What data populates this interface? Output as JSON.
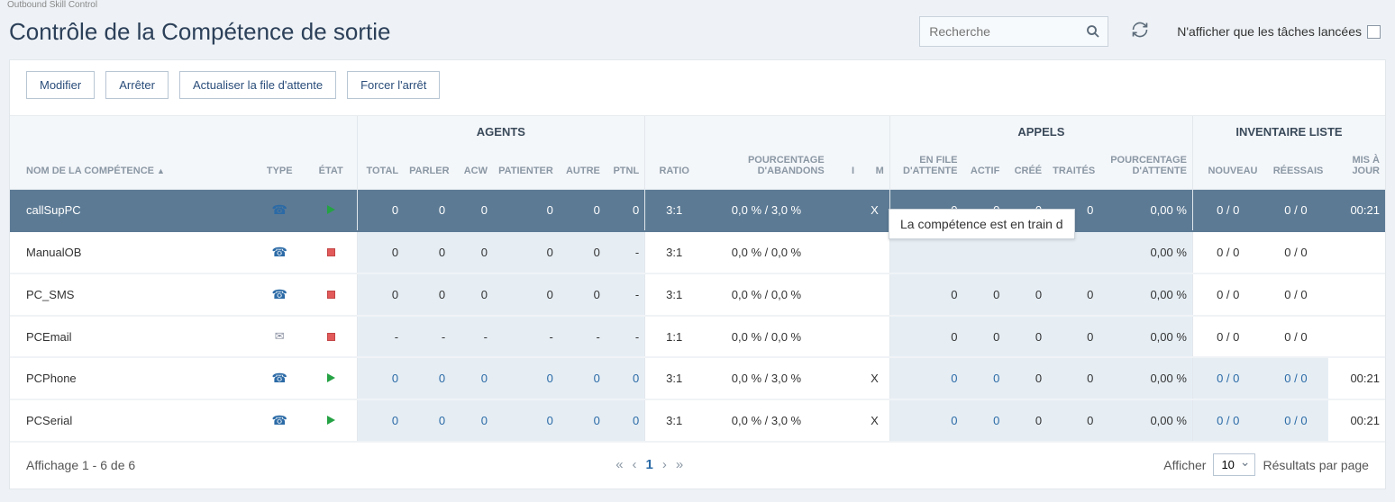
{
  "top_fragment": "Outbound Skill Control",
  "page_title": "Contrôle de la Compétence de sortie",
  "search": {
    "placeholder": "Recherche"
  },
  "show_only_label": "N'afficher que les tâches lancées",
  "buttons": {
    "modify": "Modifier",
    "stop": "Arrêter",
    "refresh_queue": "Actualiser la file d'attente",
    "force_stop": "Forcer l'arrêt"
  },
  "group_headers": {
    "blank": "",
    "agents": "AGENTS",
    "ratio_section": "",
    "calls": "APPELS",
    "inventory": "INVENTAIRE LISTE"
  },
  "columns": {
    "skill_name": "NOM DE LA COMPÉTENCE",
    "type": "TYPE",
    "state": "ÉTAT",
    "total": "TOTAL",
    "talking": "PARLER",
    "acw": "ACW",
    "waiting": "PATIENTER",
    "other": "AUTRE",
    "ptnl": "PTNL",
    "ratio": "RATIO",
    "abandon_pct": "POURCENTAGE D'ABANDONS",
    "i": "I",
    "m": "M",
    "queued": "EN FILE D'ATTENTE",
    "active": "ACTIF",
    "created": "CRÉÉ",
    "handled": "TRAITÉS",
    "wait_pct": "POURCENTAGE D'ATTENTE",
    "new": "NOUVEAU",
    "retries": "RÉESSAIS",
    "updated": "MIS À JOUR"
  },
  "rows": [
    {
      "name": "callSupPC",
      "type_icon": "phone",
      "state": "green",
      "link": false,
      "selected": true,
      "total": "0",
      "talking": "0",
      "acw": "0",
      "waiting": "0",
      "other": "0",
      "ptnl": "0",
      "ratio": "3:1",
      "abandon": "0,0 % / 3,0 %",
      "i": "",
      "m": "X",
      "queued": "0",
      "active": "0",
      "created": "0",
      "handled": "0",
      "waitpct": "0,00 %",
      "new": "0 / 0",
      "retries": "0 / 0",
      "updated": "00:21"
    },
    {
      "name": "ManualOB",
      "type_icon": "phone",
      "state": "red",
      "link": false,
      "selected": false,
      "total": "0",
      "talking": "0",
      "acw": "0",
      "waiting": "0",
      "other": "0",
      "ptnl": "-",
      "ratio": "3:1",
      "abandon": "0,0 % / 0,0 %",
      "i": "",
      "m": "",
      "queued": "",
      "active": "",
      "created": "",
      "handled": "",
      "waitpct": "0,00 %",
      "new": "0 / 0",
      "retries": "0 / 0",
      "updated": ""
    },
    {
      "name": "PC_SMS",
      "type_icon": "phone",
      "state": "red",
      "link": false,
      "selected": false,
      "total": "0",
      "talking": "0",
      "acw": "0",
      "waiting": "0",
      "other": "0",
      "ptnl": "-",
      "ratio": "3:1",
      "abandon": "0,0 % / 0,0 %",
      "i": "",
      "m": "",
      "queued": "0",
      "active": "0",
      "created": "0",
      "handled": "0",
      "waitpct": "0,00 %",
      "new": "0 / 0",
      "retries": "0 / 0",
      "updated": ""
    },
    {
      "name": "PCEmail",
      "type_icon": "mail",
      "state": "red",
      "link": false,
      "selected": false,
      "total": "-",
      "talking": "-",
      "acw": "-",
      "waiting": "-",
      "other": "-",
      "ptnl": "-",
      "ratio": "1:1",
      "abandon": "0,0 % / 0,0 %",
      "i": "",
      "m": "",
      "queued": "0",
      "active": "0",
      "created": "0",
      "handled": "0",
      "waitpct": "0,00 %",
      "new": "0 / 0",
      "retries": "0 / 0",
      "updated": ""
    },
    {
      "name": "PCPhone",
      "type_icon": "phone",
      "state": "green",
      "link": true,
      "selected": false,
      "total": "0",
      "talking": "0",
      "acw": "0",
      "waiting": "0",
      "other": "0",
      "ptnl": "0",
      "ratio": "3:1",
      "abandon": "0,0 % / 3,0 %",
      "i": "",
      "m": "X",
      "queued": "0",
      "active": "0",
      "created": "0",
      "handled": "0",
      "waitpct": "0,00 %",
      "new": "0 / 0",
      "retries": "0 / 0",
      "updated": "00:21"
    },
    {
      "name": "PCSerial",
      "type_icon": "phone",
      "state": "green",
      "link": true,
      "selected": false,
      "total": "0",
      "talking": "0",
      "acw": "0",
      "waiting": "0",
      "other": "0",
      "ptnl": "0",
      "ratio": "3:1",
      "abandon": "0,0 % / 3,0 %",
      "i": "",
      "m": "X",
      "queued": "0",
      "active": "0",
      "created": "0",
      "handled": "0",
      "waitpct": "0,00 %",
      "new": "0 / 0",
      "retries": "0 / 0",
      "updated": "00:21"
    }
  ],
  "tooltip": "La compétence est en train d",
  "footer": {
    "display_text": "Affichage 1 - 6 de 6",
    "page_num": "1",
    "show_label": "Afficher",
    "page_size": "10",
    "results_label": "Résultats par page"
  }
}
